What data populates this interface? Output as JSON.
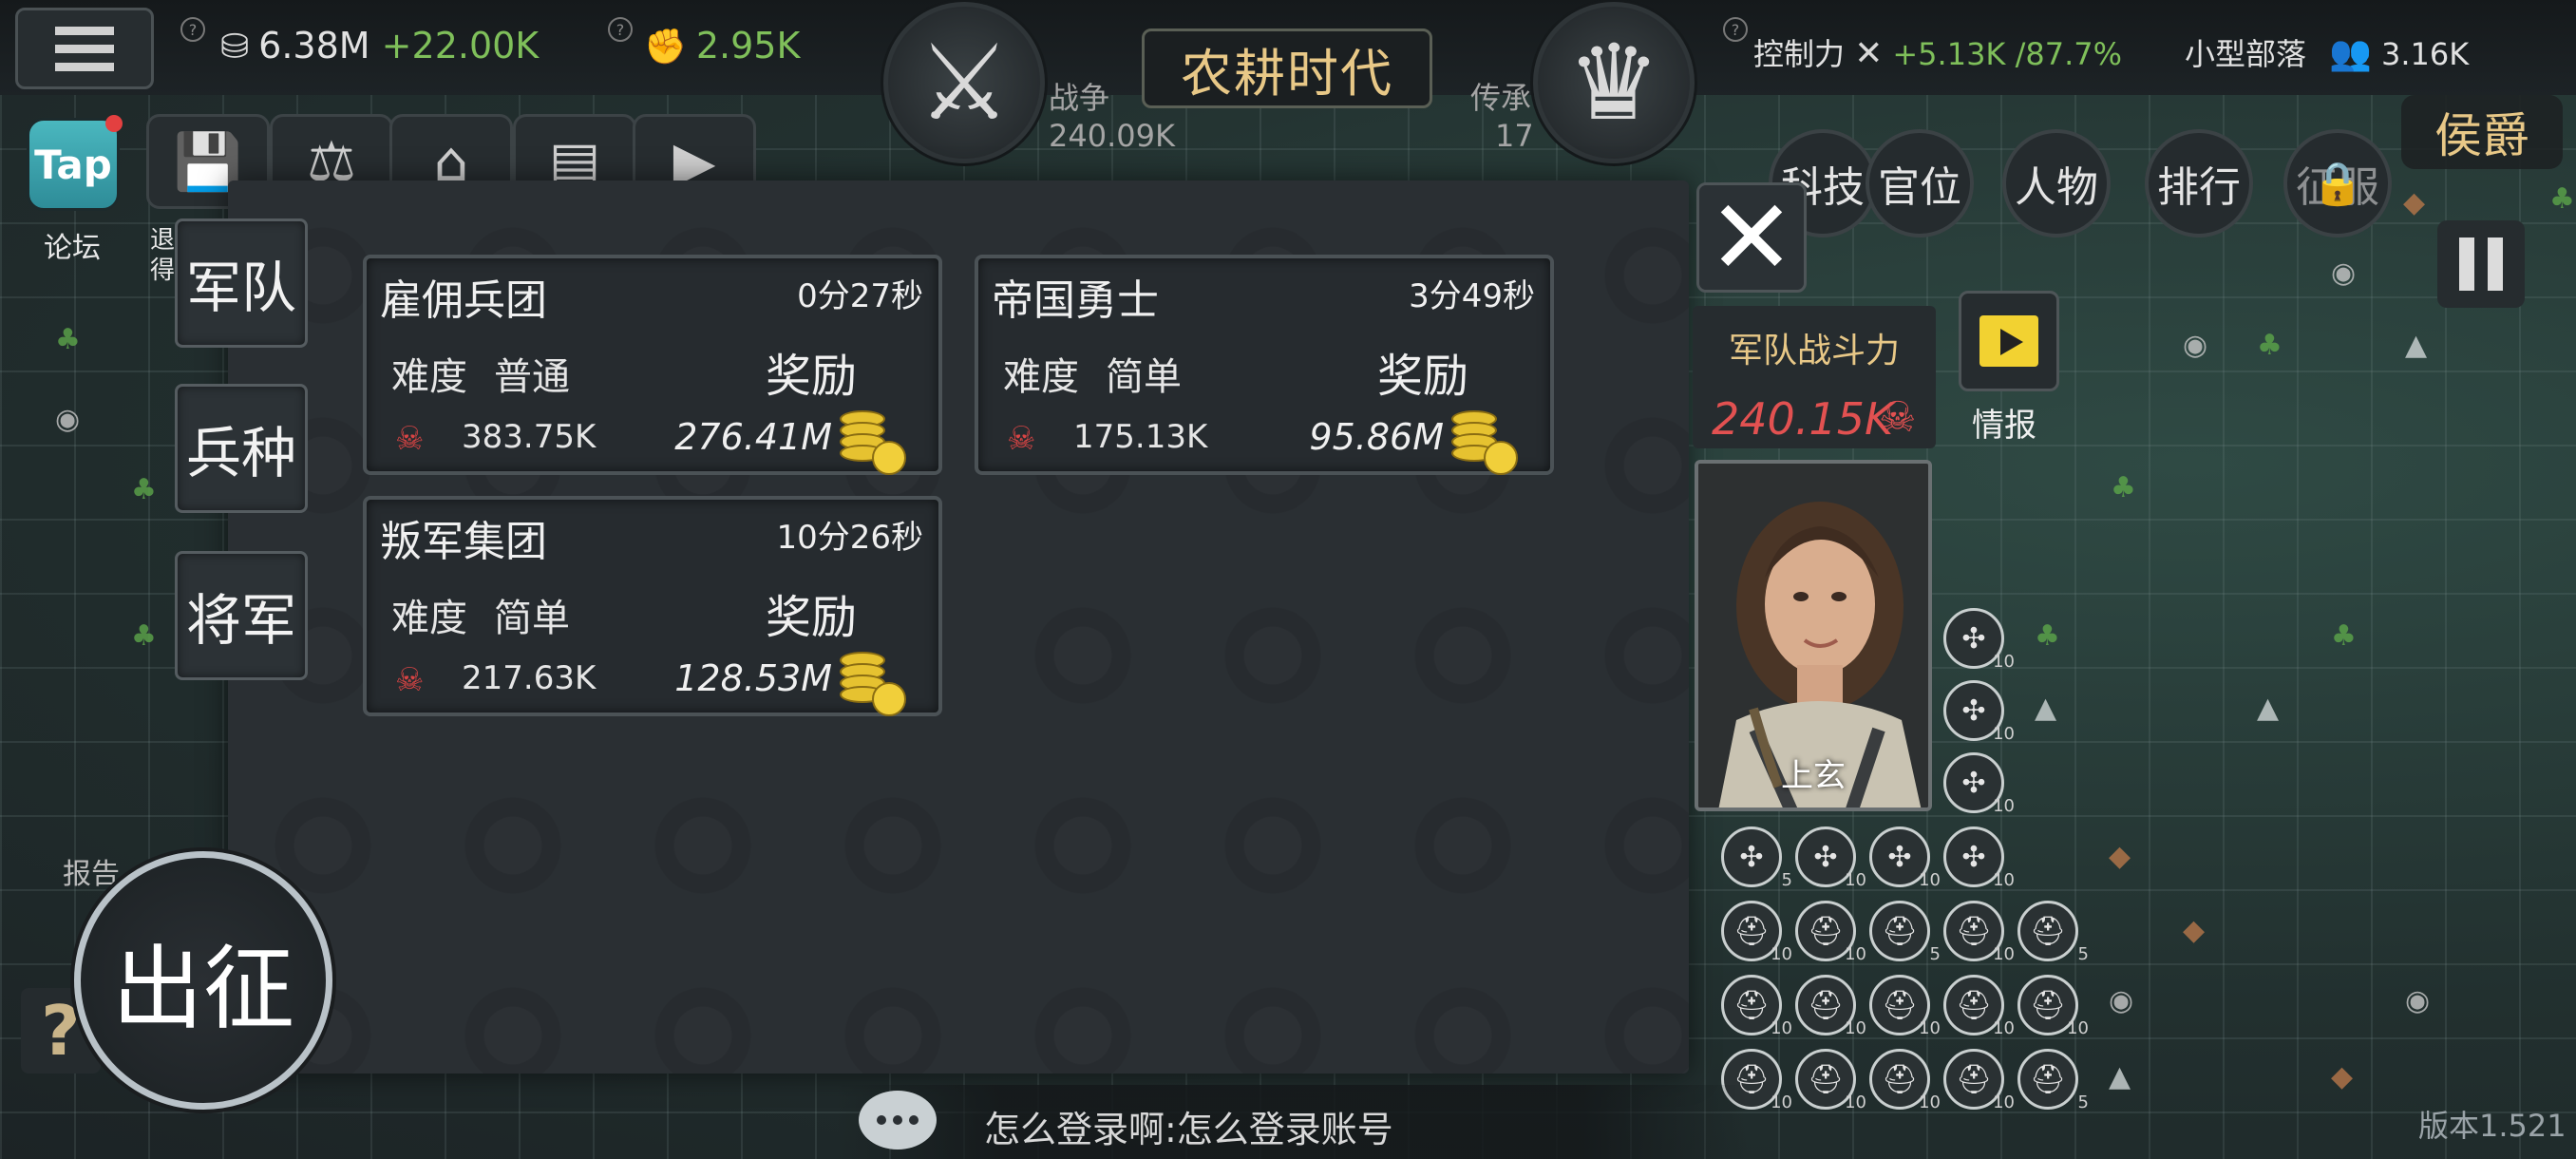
{
  "topbar": {
    "gold": "6.38M",
    "gold_delta": "+22.00K",
    "strength": "2.95K",
    "war_label": "战争",
    "war_value": "240.09K",
    "era": "农耕时代",
    "legacy_label": "传承",
    "legacy_value": "17",
    "control_label": "控制力",
    "control_delta": "+5.13K /87.7%",
    "tribe_label": "小型部落",
    "population": "3.16K",
    "rank_title": "侯爵",
    "help_mark": "?"
  },
  "left": {
    "tap_label": "Tap",
    "forum_label": "论坛",
    "cut_label_1": "退",
    "cut_label_2": "得"
  },
  "right_menu": [
    "科技",
    "官位",
    "人物",
    "排行",
    "征服"
  ],
  "side_tabs": [
    "军队",
    "兵种",
    "将军"
  ],
  "missions": [
    {
      "name": "雇佣兵团",
      "time": "0分27秒",
      "difficulty_label": "难度",
      "difficulty": "普通",
      "reward_label": "奖励",
      "power": "383.75K",
      "reward": "276.41M"
    },
    {
      "name": "帝国勇士",
      "time": "3分49秒",
      "difficulty_label": "难度",
      "difficulty": "简单",
      "reward_label": "奖励",
      "power": "175.13K",
      "reward": "95.86M"
    },
    {
      "name": "叛军集团",
      "time": "10分26秒",
      "difficulty_label": "难度",
      "difficulty": "简单",
      "reward_label": "奖励",
      "power": "217.63K",
      "reward": "128.53M"
    }
  ],
  "army": {
    "power_label": "军队战斗力",
    "power_value": "240.15K",
    "info_label": "情报",
    "general_name": "上玄"
  },
  "bottom": {
    "go_label": "出征",
    "report_label": "报告",
    "help": "?",
    "chat_text": "怎么登录啊:怎么登录账号",
    "version": "版本1.521"
  },
  "colors": {
    "accent_gold": "#e8c887",
    "gain_green": "#7fbf5a",
    "danger_red": "#e25151"
  }
}
